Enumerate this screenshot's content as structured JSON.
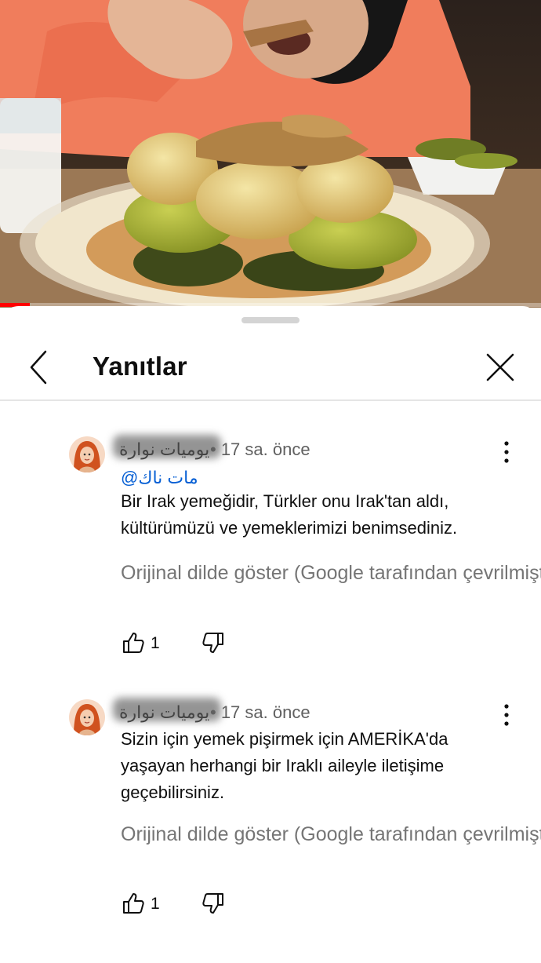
{
  "video": {
    "progress_fraction": 0.055,
    "accent_color": "#ff0000"
  },
  "sheet": {
    "title": "Yanıtlar",
    "back_icon": "chevron-left-icon",
    "close_icon": "close-icon"
  },
  "comments": [
    {
      "author": "يوميات نوارة",
      "time": "• 17 sa. önce",
      "mention": "@مات ناك",
      "text_lines": [
        "Bir Irak yemeğidir, Türkler onu Irak'tan aldı,",
        "kültürümüzü ve yemeklerimizi benimsediniz."
      ],
      "translate_label": "Orijinal dilde göster (Google tarafından çevrilmiştir)",
      "likes": "1"
    },
    {
      "author": "يوميات نوارة",
      "time": "• 17 sa. önce",
      "text_lines": [
        "Sizin için yemek pişirmek için AMERİKA'da",
        "yaşayan herhangi bir Iraklı aileyle iletişime",
        "geçebilirsiniz."
      ],
      "translate_label": "Orijinal dilde göster (Google tarafından çevrilmiştir)",
      "likes": "1"
    }
  ]
}
